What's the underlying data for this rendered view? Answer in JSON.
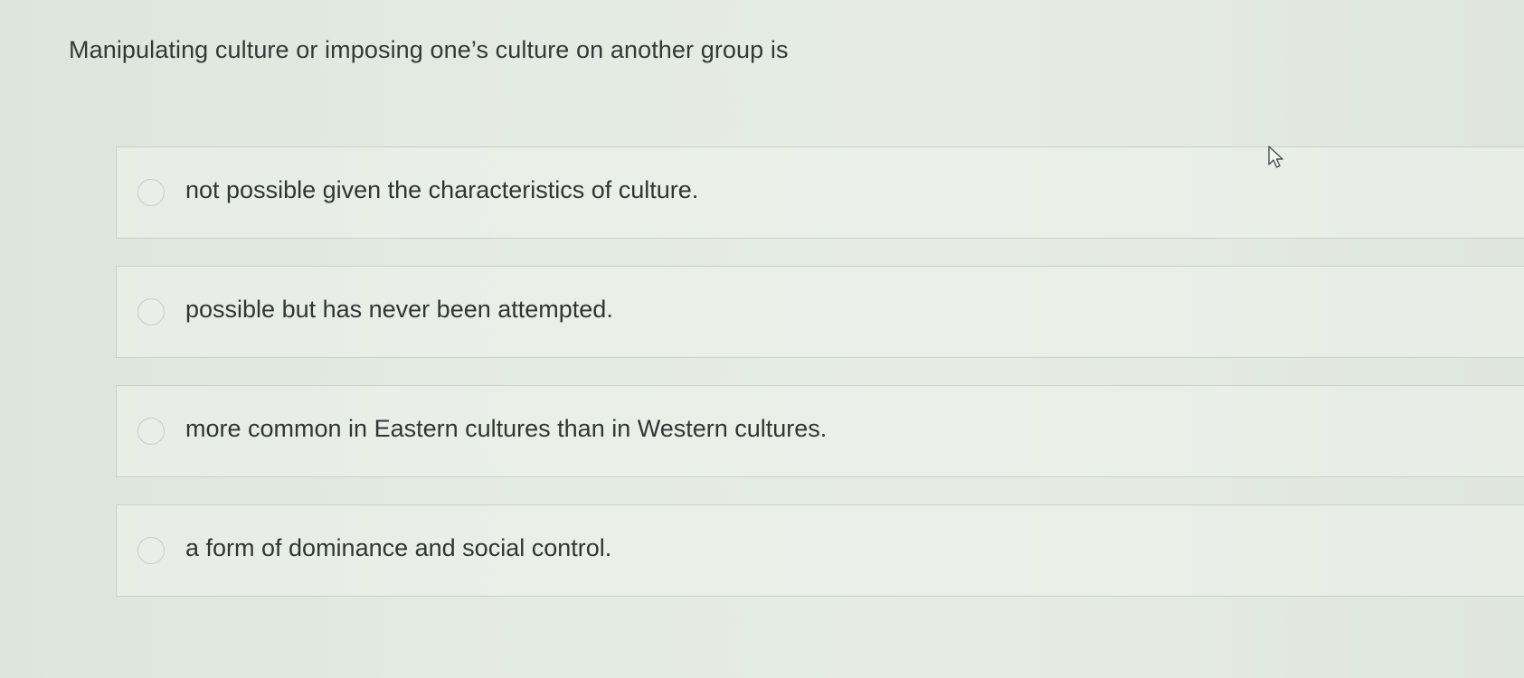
{
  "question": {
    "text": "Manipulating culture or imposing one’s culture on another group is"
  },
  "options": [
    {
      "label": "not possible given the characteristics of culture.",
      "selected": false
    },
    {
      "label": "possible but has never been attempted.",
      "selected": false
    },
    {
      "label": "more common in Eastern cultures than in Western cultures.",
      "selected": false
    },
    {
      "label": "a form of dominance and social control.",
      "selected": false
    }
  ],
  "colors": {
    "background": "#e4ebe3",
    "text": "#2f3634",
    "border": "#c9d1c8"
  },
  "icons": {
    "radio": "radio-unselected-icon",
    "cursor": "mouse-pointer-icon"
  }
}
